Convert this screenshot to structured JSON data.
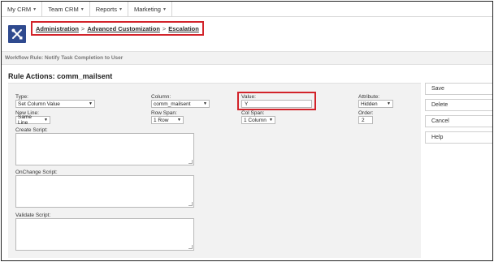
{
  "topnav": {
    "items": [
      {
        "label": "My CRM"
      },
      {
        "label": "Team CRM"
      },
      {
        "label": "Reports"
      },
      {
        "label": "Marketing"
      }
    ]
  },
  "header": {
    "logo_icon": "tools-icon",
    "breadcrumb": [
      {
        "label": "Administration"
      },
      {
        "label": "Advanced Customization"
      },
      {
        "label": "Escalation"
      }
    ],
    "separator": ">"
  },
  "subtitle": "Workflow Rule: Notify Task Completion to User",
  "rule_title": "Rule Actions: comm_mailsent",
  "form": {
    "type": {
      "label": "Type:",
      "value": "Set Column Value"
    },
    "column": {
      "label": "Column:",
      "value": "comm_mailsent"
    },
    "value": {
      "label": "Value:",
      "value": "Y"
    },
    "attribute": {
      "label": "Attribute:",
      "value": "Hidden"
    },
    "new_line": {
      "label": "New Line:",
      "value": "Same Line"
    },
    "row_span": {
      "label": "Row Span:",
      "value": "1 Row"
    },
    "col_span": {
      "label": "Col Span:",
      "value": "1 Column"
    },
    "order": {
      "label": "Order:",
      "value": "2"
    },
    "create_script": {
      "label": "Create Script:"
    },
    "onchange_script": {
      "label": "OnChange Script:"
    },
    "validate_script": {
      "label": "Validate Script:"
    }
  },
  "buttons": {
    "save": "Save",
    "delete": "Delete",
    "cancel": "Cancel",
    "help": "Help"
  },
  "colors": {
    "highlight": "#d2232a",
    "logo_bg": "#2f4a8f",
    "panel_bg": "#f2f2f2"
  }
}
